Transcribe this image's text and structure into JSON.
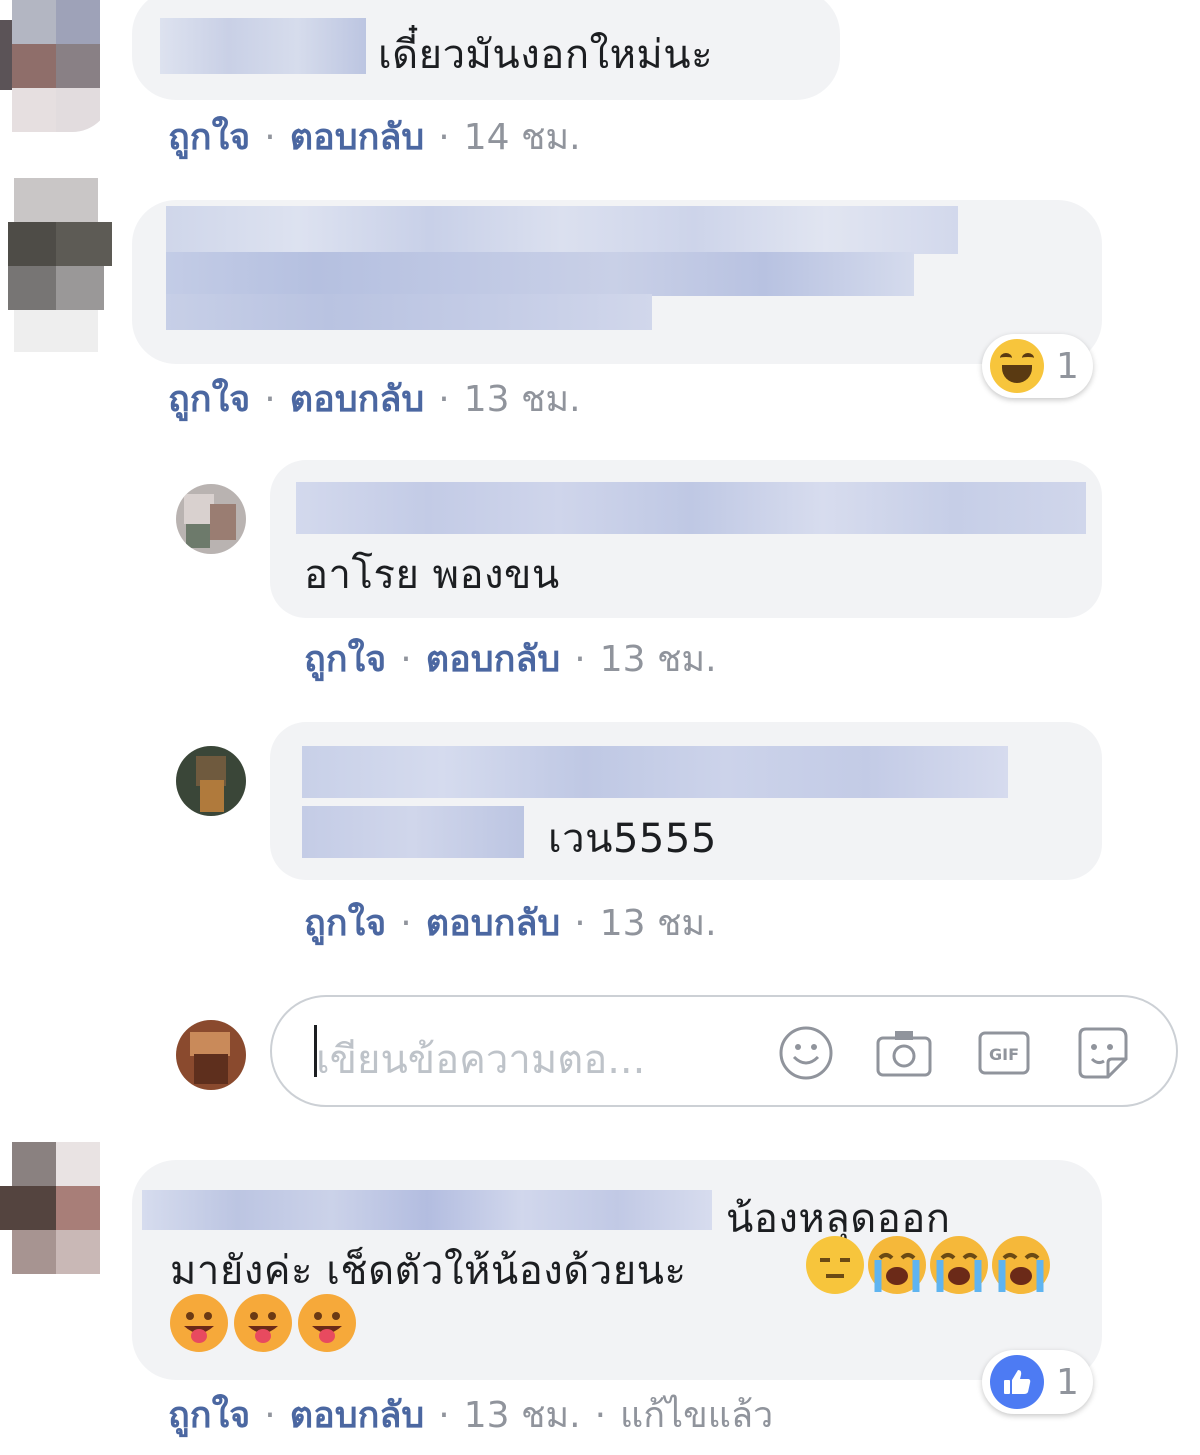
{
  "comments": [
    {
      "text": "เดี๋ยวมันงอกใหม่นะ",
      "actions": {
        "like": "ถูกใจ",
        "reply": "ตอบกลับ",
        "time": "14 ชม."
      }
    },
    {
      "text": "",
      "actions": {
        "like": "ถูกใจ",
        "reply": "ตอบกลับ",
        "time": "13 ชม."
      },
      "reaction": {
        "icon": "haha-icon",
        "count": "1"
      }
    },
    {
      "text": "อาโรย พองขน",
      "actions": {
        "like": "ถูกใจ",
        "reply": "ตอบกลับ",
        "time": "13 ชม."
      }
    },
    {
      "text": "เวน5555",
      "actions": {
        "like": "ถูกใจ",
        "reply": "ตอบกลับ",
        "time": "13 ชม."
      }
    },
    {
      "text_line1": "น้องหลุดออก",
      "text_line2": "มายังค่ะ เช็ดตัวให้น้องด้วยนะ",
      "emojis": [
        "sleepy-face-icon",
        "crying-face-icon",
        "crying-face-icon",
        "crying-face-icon",
        "tongue-face-icon",
        "tongue-face-icon",
        "tongue-face-icon"
      ],
      "actions": {
        "like": "ถูกใจ",
        "reply": "ตอบกลับ",
        "time": "13 ชม.",
        "edited": "แก้ไขแล้ว"
      },
      "reaction": {
        "icon": "like-icon",
        "count": "1"
      }
    }
  ],
  "composer": {
    "placeholder": "เขียนข้อความตอ...",
    "icons": [
      "smiley-icon",
      "camera-icon",
      "gif-icon",
      "sticker-icon"
    ],
    "gif_label": "GIF"
  },
  "colors": {
    "link": "#4b67a1",
    "meta": "#90949c",
    "bubble": "#f2f3f5",
    "like_blue": "#4d7bf3",
    "haha_yellow": "#f7c53c"
  }
}
